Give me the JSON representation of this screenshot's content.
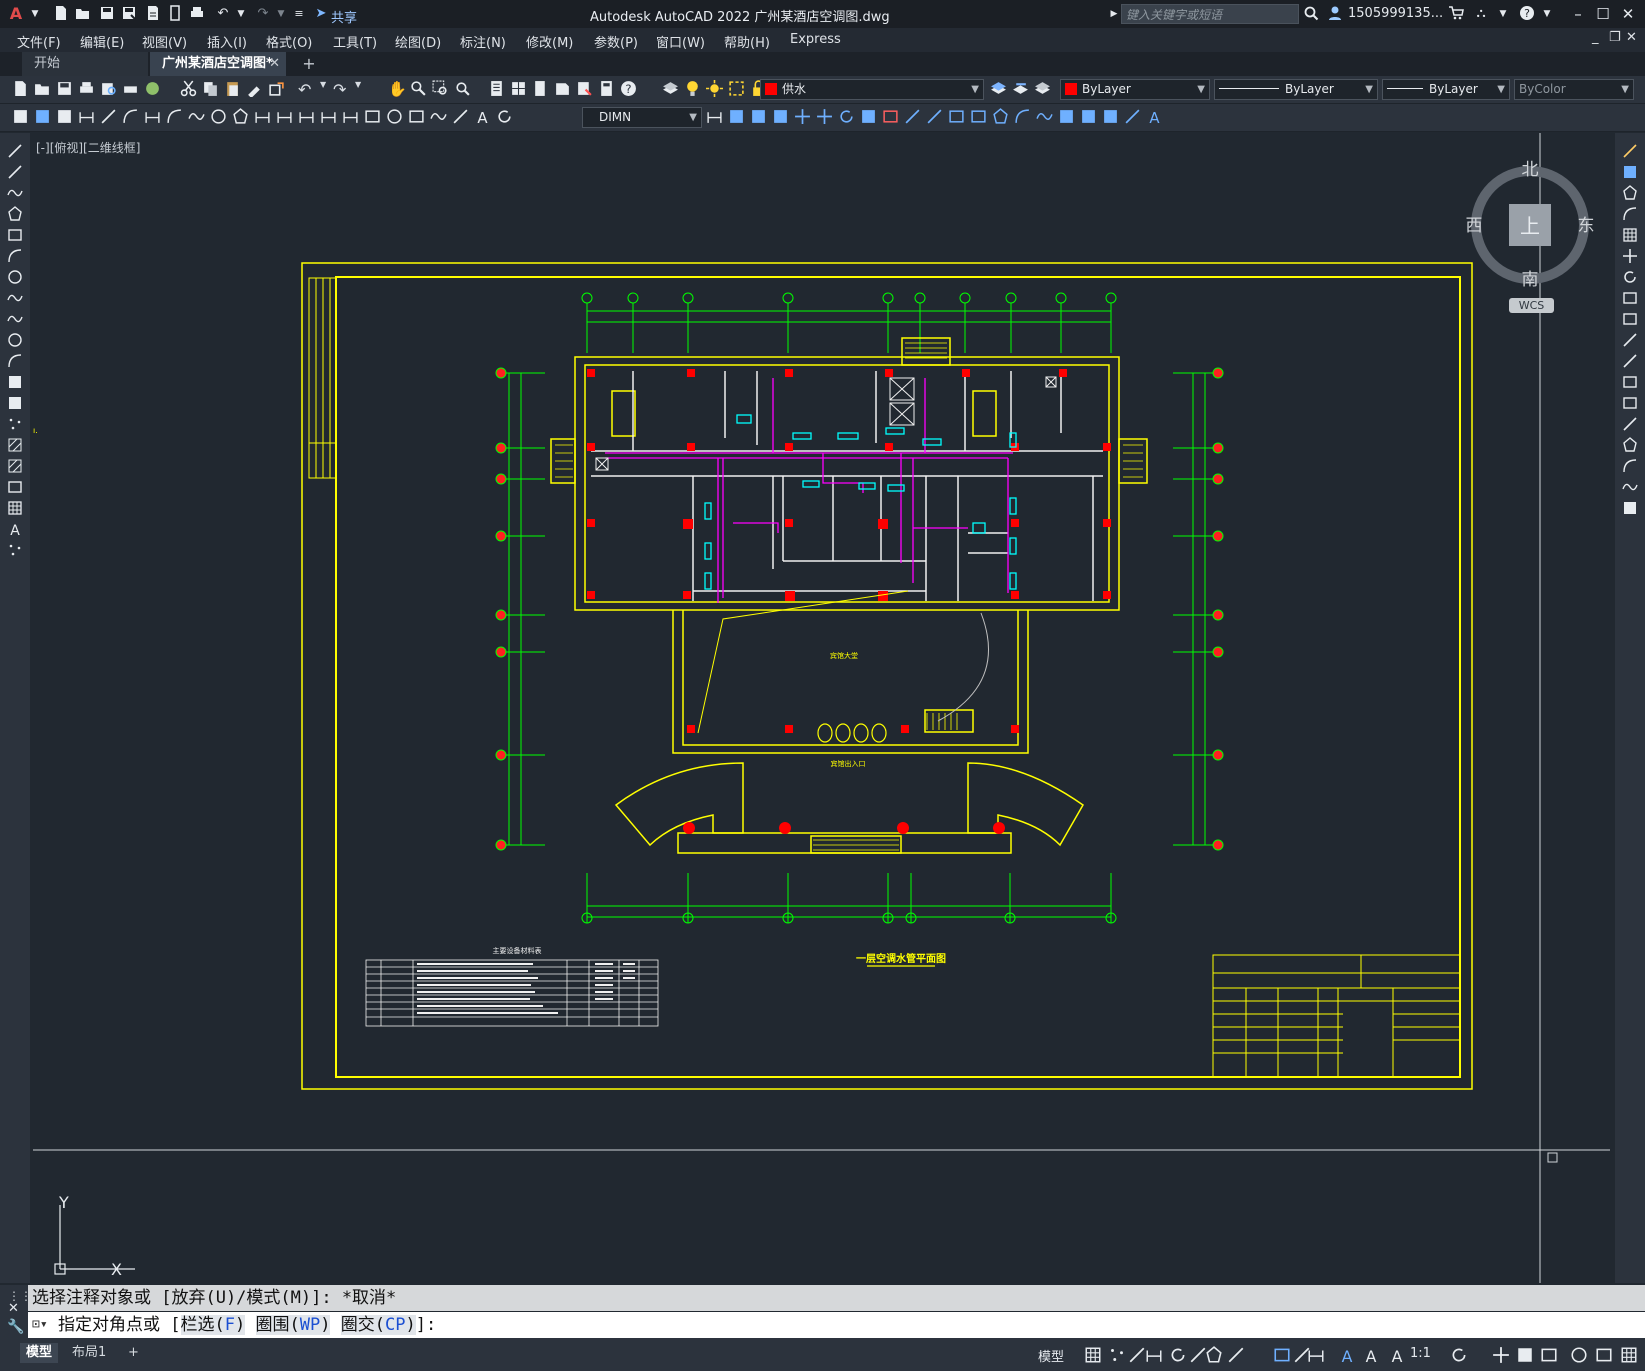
{
  "app": {
    "title": "Autodesk AutoCAD 2022    广州某酒店空调图.dwg",
    "logo": "A",
    "share_label": "共享",
    "search_placeholder": "键入关键字或短语",
    "user": "1505999135..."
  },
  "menu": [
    "文件(F)",
    "编辑(E)",
    "视图(V)",
    "插入(I)",
    "格式(O)",
    "工具(T)",
    "绘图(D)",
    "标注(N)",
    "修改(M)",
    "参数(P)",
    "窗口(W)",
    "帮助(H)",
    "Express"
  ],
  "tabs": {
    "start": "开始",
    "file": "广州某酒店空调图*",
    "close": "✕",
    "add": "+"
  },
  "toolbar": {
    "layer": "供水",
    "color": "ByLayer",
    "linetype": "ByLayer",
    "lineweight": "ByLayer",
    "plotstyle": "ByColor",
    "dimstyle": "DIMN"
  },
  "viewport": {
    "label": "[-][俯视][二维线框]"
  },
  "viewcube": {
    "north": "北",
    "south": "南",
    "east": "东",
    "west": "西",
    "top": "上",
    "wcs": "WCS"
  },
  "ucs": {
    "x": "X",
    "y": "Y"
  },
  "drawing": {
    "plan_title": "一层空调水管平面图",
    "table_title": "主要设备材料表",
    "entrance": "宾馆出入口",
    "lobby": "宾馆大堂"
  },
  "command": {
    "history": "选择注释对象或 [放弃(U)/模式(M)]: *取消*",
    "prompt": "指定对角点或",
    "options": [
      {
        "label": "栏选(",
        "key": "F",
        "end": ")"
      },
      {
        "label": "圈围(",
        "key": "WP",
        "end": ")"
      },
      {
        "label": "圈交(",
        "key": "CP",
        "end": ")"
      }
    ],
    "suffix": "]:"
  },
  "status": {
    "layouts": [
      "模型",
      "布局1",
      "+"
    ],
    "model": "模型",
    "scale": "1:1"
  },
  "colors": {
    "border": "#ffff00",
    "axis": "#00ff00",
    "wall": "#f0f0f0",
    "pipe": "#ff00ff",
    "column": "#ff0000",
    "equipment": "#00ffff"
  }
}
